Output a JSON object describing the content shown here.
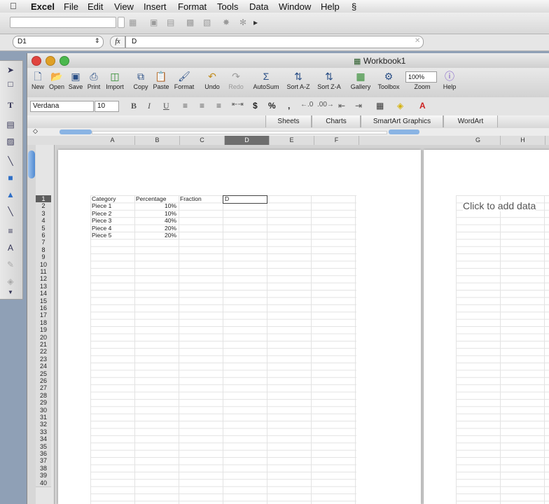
{
  "menubar": {
    "app": "Excel",
    "items": [
      "File",
      "Edit",
      "View",
      "Insert",
      "Format",
      "Tools",
      "Data",
      "Window",
      "Help"
    ]
  },
  "formula_bar": {
    "cell_ref": "D1",
    "fx": "fx",
    "content": "D"
  },
  "window": {
    "title": "Workbook1"
  },
  "toolbar": {
    "buttons": [
      {
        "label": "New",
        "icon": "new-document-icon"
      },
      {
        "label": "Open",
        "icon": "open-folder-icon"
      },
      {
        "label": "Save",
        "icon": "save-disk-icon"
      },
      {
        "label": "Print",
        "icon": "printer-icon"
      },
      {
        "label": "Import",
        "icon": "import-icon"
      },
      {
        "label": "Copy",
        "icon": "copy-icon"
      },
      {
        "label": "Paste",
        "icon": "paste-icon"
      },
      {
        "label": "Format",
        "icon": "format-brush-icon"
      },
      {
        "label": "Undo",
        "icon": "undo-icon"
      },
      {
        "label": "Redo",
        "icon": "redo-icon"
      },
      {
        "label": "AutoSum",
        "icon": "autosum-icon"
      },
      {
        "label": "Sort A-Z",
        "icon": "sort-az-icon"
      },
      {
        "label": "Sort Z-A",
        "icon": "sort-za-icon"
      },
      {
        "label": "Gallery",
        "icon": "gallery-icon"
      },
      {
        "label": "Toolbox",
        "icon": "toolbox-icon"
      },
      {
        "label": "Zoom",
        "icon": "zoom-icon"
      },
      {
        "label": "Help",
        "icon": "help-icon"
      }
    ],
    "zoom_value": "100%"
  },
  "format_bar": {
    "font": "Verdana",
    "size": "10"
  },
  "gallery_tabs": [
    "Sheets",
    "Charts",
    "SmartArt Graphics",
    "WordArt"
  ],
  "columns": [
    "A",
    "B",
    "C",
    "D",
    "E",
    "F",
    "G",
    "H"
  ],
  "selected_column": "D",
  "selected_row": 1,
  "rows": [
    "1",
    "2",
    "3",
    "4",
    "5",
    "6",
    "7",
    "8",
    "9",
    "10",
    "11",
    "12",
    "13",
    "14",
    "15",
    "16",
    "17",
    "18",
    "19",
    "20",
    "21",
    "22",
    "23",
    "24",
    "25",
    "26",
    "27",
    "28",
    "29",
    "30",
    "31",
    "32",
    "33",
    "34",
    "35",
    "36",
    "37",
    "38",
    "39",
    "40"
  ],
  "sheet": {
    "headers": [
      "Category",
      "Percentage",
      "Fraction",
      "D"
    ],
    "data": [
      [
        "Piece 1",
        "10%"
      ],
      [
        "Piece 2",
        "10%"
      ],
      [
        "Piece 3",
        "40%"
      ],
      [
        "Piece 4",
        "20%"
      ],
      [
        "Piece 5",
        "20%"
      ]
    ]
  },
  "placeholder_text": "Click to add data"
}
